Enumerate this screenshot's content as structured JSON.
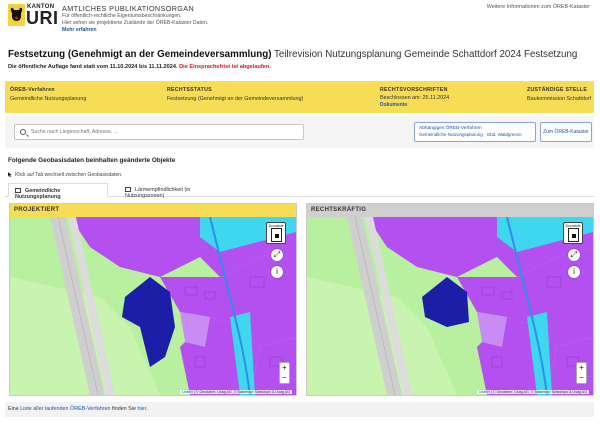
{
  "header": {
    "logo_kanton": "KANTON",
    "logo_uri": "URI",
    "org_title": "AMTLICHES PUBLIKATIONSORGAN",
    "org_line1": "Für öffentlich-rechtliche Eigentumsbeschränkungen.",
    "org_line2": "Hier sehen sie projektierte Zustände der ÖREB-Kataster Daten.",
    "org_link": "Mehr erfahren",
    "right_link": "Weitere Informationen zum ÖREB-Kataster"
  },
  "title": {
    "strong": "Festsetzung (Genehmigt an der Gemeindeversammlung)",
    "rest": " Teilrevision Nutzungsplanung Gemeinde Schattdorf 2024 Festsetzung"
  },
  "notice": {
    "text": "Die öffentliche Auflage fand statt vom 11.10.2024 bis 11.11.2024.",
    "red": " Die Einsprachefrist ist abgelaufen."
  },
  "info": {
    "col1_label": "ÖREB-Verfahren",
    "col1_value": "Gemeindliche Nutzungsplanung",
    "col2_label": "RECHTSSTATUS",
    "col2_value": "Festsetzung (Genehmigt an der Gemeindeversammlung)",
    "col3_label": "RECHTSVORSCHRIFTEN",
    "col3_value": "Beschlossen am: 25.11.2024",
    "col3_sub": "Dokumente",
    "col4_label": "ZUSTÄNDIGE STELLE",
    "col4_value": "Baukommission Schattdorf"
  },
  "search": {
    "placeholder": "Suche nach Liegenschaft, Adresse, ...",
    "dep_title": "Abhängiges ÖREB-Verfahren",
    "dep_sub": "Gemeindliche Nutzungsplanung - Gbd. Waldgrenze",
    "kataster_button": "Zum ÖREB-Kataster"
  },
  "section": {
    "title": "Folgende Geobasisdaten beinhalten geänderte Objekte",
    "hint": "Klick auf Tab wechselt zwischen Geobasisdaten."
  },
  "tabs": [
    {
      "label": "Gemeindliche Nutzungsplanung"
    },
    {
      "label": "Lärmempfindlichkeit (in Nutzungszonen)"
    }
  ],
  "maps": {
    "left_title": "PROJEKTIERT",
    "right_title": "RECHTSKRÄFTIG",
    "overview_label": "Zoomstufe",
    "zoom_in": "+",
    "zoom_out": "−",
    "attrib_link": "Leaflet",
    "attrib_text": " | © Geodaten: Lisag AG, © Basemap: Swisstopo & Lisag AG"
  },
  "footer": {
    "prefix": "Eine ",
    "link1": "Liste aller laufenden ÖREB-Verfahren",
    "middle": " finden Sie ",
    "link2": "hier",
    "suffix": "."
  },
  "colors": {
    "accent_yellow": "#f7dc55",
    "link_blue": "#1a56b0",
    "alert_red": "#d01919",
    "zone_purple": "#b44ff0",
    "zone_blue": "#1b1fa8",
    "zone_cyan": "#3fd7ef",
    "zone_green": "#b8f0a0"
  }
}
